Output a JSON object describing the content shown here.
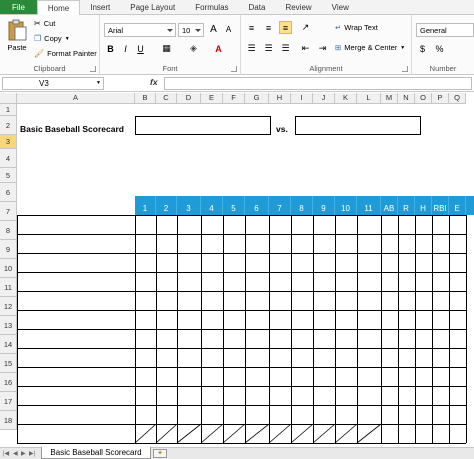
{
  "ribbon_tabs": [
    "File",
    "Home",
    "Insert",
    "Page Layout",
    "Formulas",
    "Data",
    "Review",
    "View"
  ],
  "active_tab": "Home",
  "clipboard": {
    "paste": "Paste",
    "cut": "Cut",
    "copy": "Copy",
    "format_painter": "Format Painter",
    "label": "Clipboard"
  },
  "font": {
    "name": "Arial",
    "size": "10",
    "label": "Font"
  },
  "alignment": {
    "wrap_text": "Wrap Text",
    "merge_center": "Merge & Center",
    "label": "Alignment"
  },
  "number": {
    "format": "General",
    "label": "Number"
  },
  "formula_bar": {
    "name_box": "V3",
    "fx": "fx",
    "value": ""
  },
  "columns": [
    "A",
    "B",
    "C",
    "D",
    "E",
    "F",
    "G",
    "H",
    "I",
    "J",
    "K",
    "L",
    "M",
    "N",
    "O",
    "P",
    "Q"
  ],
  "rows": [
    "1",
    "2",
    "3",
    "4",
    "5",
    "6",
    "7",
    "8",
    "9",
    "10",
    "11",
    "12",
    "13",
    "14",
    "15",
    "16",
    "17",
    "18"
  ],
  "active_row": "3",
  "sheet": {
    "title": "Basic Baseball Scorecard",
    "vs": "vs.",
    "header_cells": [
      "1",
      "2",
      "3",
      "4",
      "5",
      "6",
      "7",
      "8",
      "9",
      "10",
      "11",
      "AB",
      "R",
      "H",
      "RBI",
      "E"
    ],
    "header_color": "#1f9bd7"
  },
  "sheet_tabs": [
    "Basic Baseball Scorecard"
  ],
  "colors": {
    "file_tab": "#2a8a3a",
    "active_row": "#f7d879"
  }
}
